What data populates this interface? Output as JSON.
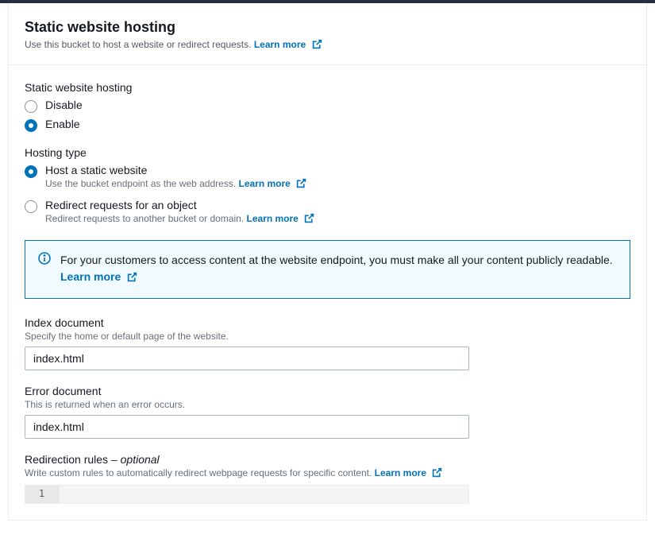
{
  "header": {
    "title": "Static website hosting",
    "description": "Use this bucket to host a website or redirect requests.",
    "learn_more": "Learn more"
  },
  "hosting_section": {
    "label": "Static website hosting",
    "disable": "Disable",
    "enable": "Enable"
  },
  "hosting_type": {
    "label": "Hosting type",
    "static": {
      "label": "Host a static website",
      "desc": "Use the bucket endpoint as the web address.",
      "learn_more": "Learn more"
    },
    "redirect": {
      "label": "Redirect requests for an object",
      "desc": "Redirect requests to another bucket or domain.",
      "learn_more": "Learn more"
    }
  },
  "info_box": {
    "text": "For your customers to access content at the website endpoint, you must make all your content publicly readable.",
    "learn_more": "Learn more"
  },
  "index_doc": {
    "label": "Index document",
    "desc": "Specify the home or default page of the website.",
    "value": "index.html"
  },
  "error_doc": {
    "label": "Error document",
    "desc": "This is returned when an error occurs.",
    "value": "index.html"
  },
  "redirection": {
    "label": "Redirection rules",
    "optional": " – optional",
    "desc": "Write custom rules to automatically redirect webpage requests for specific content.",
    "learn_more": "Learn more",
    "line_number": "1"
  }
}
